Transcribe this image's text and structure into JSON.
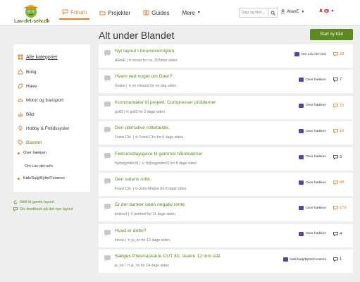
{
  "header": {
    "logo_text": "Lav-det-selv.dk",
    "nav": [
      {
        "label": "Forum",
        "icon": "chat-icon"
      },
      {
        "label": "Projekter",
        "icon": "folder-icon"
      },
      {
        "label": "Guides",
        "icon": "book-icon"
      },
      {
        "label": "Mere",
        "icon": "chevron-down-icon"
      }
    ],
    "search_placeholder": "Søg og find...",
    "user_name": "AllanE",
    "notification_count": "8"
  },
  "page": {
    "title": "Alt under Blandet",
    "start_button": "Start ny tråd"
  },
  "sidebar": {
    "items": [
      {
        "label": "Alle kategorier"
      },
      {
        "label": "Bolig"
      },
      {
        "label": "Have"
      },
      {
        "label": "Motor og transport"
      },
      {
        "label": "Båd"
      },
      {
        "label": "Hobby & Fritidssysler"
      },
      {
        "label": "Blandet"
      },
      {
        "label": "Over hækken"
      },
      {
        "label": "Om Lav-det-selv"
      },
      {
        "label": "Køb/Salg/Bytte/Foræres"
      }
    ],
    "links": [
      {
        "label": "Skift til gamle layout"
      },
      {
        "label": "Giv feedback på det nye layout"
      }
    ]
  },
  "topics": [
    {
      "title": "Nyt layout i forumoversigten",
      "author": "AllanE",
      "last": "kovas for ca. 20 timer siden",
      "category": "Om Lav-det-selv",
      "count": "28",
      "hot": true
    },
    {
      "title": "Hvem ved noget om Duer?",
      "author": "Snake",
      "last": "ev elmand for en dag siden",
      "category": "Over hækken",
      "count": "7",
      "hot": false
    },
    {
      "title": "Kommentarer til projekt: Compresser problemer",
      "author": "golf3",
      "last": "golf3 for 2 dage siden",
      "category": "Over hækken",
      "count": "16",
      "hot": true
    },
    {
      "title": "Den ultimative rottefælde..",
      "author": "Frank Chr.",
      "last": "Frank Chr. for 6 dage siden",
      "category": "Over hækken",
      "count": "15",
      "hot": true
    },
    {
      "title": "Fødselsdagsgave til gammel håndværker",
      "author": "Nybegynder91",
      "last": "Nybegynder91 for 8 dage siden",
      "category": "Over hækken",
      "count": "3",
      "hot": false
    },
    {
      "title": "Den satans rotte..",
      "author": "Frank Chr.",
      "last": "John Marjoe for 8 dage siden",
      "category": "Over hækken",
      "count": "88",
      "hot": true
    },
    {
      "title": "Er der banker uden negativ rente",
      "author": "jetdreef",
      "last": "jetdreef for 11 dage siden",
      "category": "Over hækken",
      "count": "176",
      "hot": true
    },
    {
      "title": "Hvad er dette?",
      "author": "kovas",
      "last": "je_no for 12 dage siden",
      "category": "Over hækken",
      "count": "4",
      "hot": false
    },
    {
      "title": "Sælges Plasmaskære CUT 40, skære 12 mm stål",
      "author": "je_no",
      "last": "je_no for 14 dage siden",
      "category": "Køb/Salg/Bytte/Foræres",
      "count": "1",
      "hot": false
    }
  ],
  "colors": {
    "accent": "#5d8a1e",
    "hot": "#e87d2c",
    "category": "#5a3fb0",
    "notification": "#d9534f"
  }
}
